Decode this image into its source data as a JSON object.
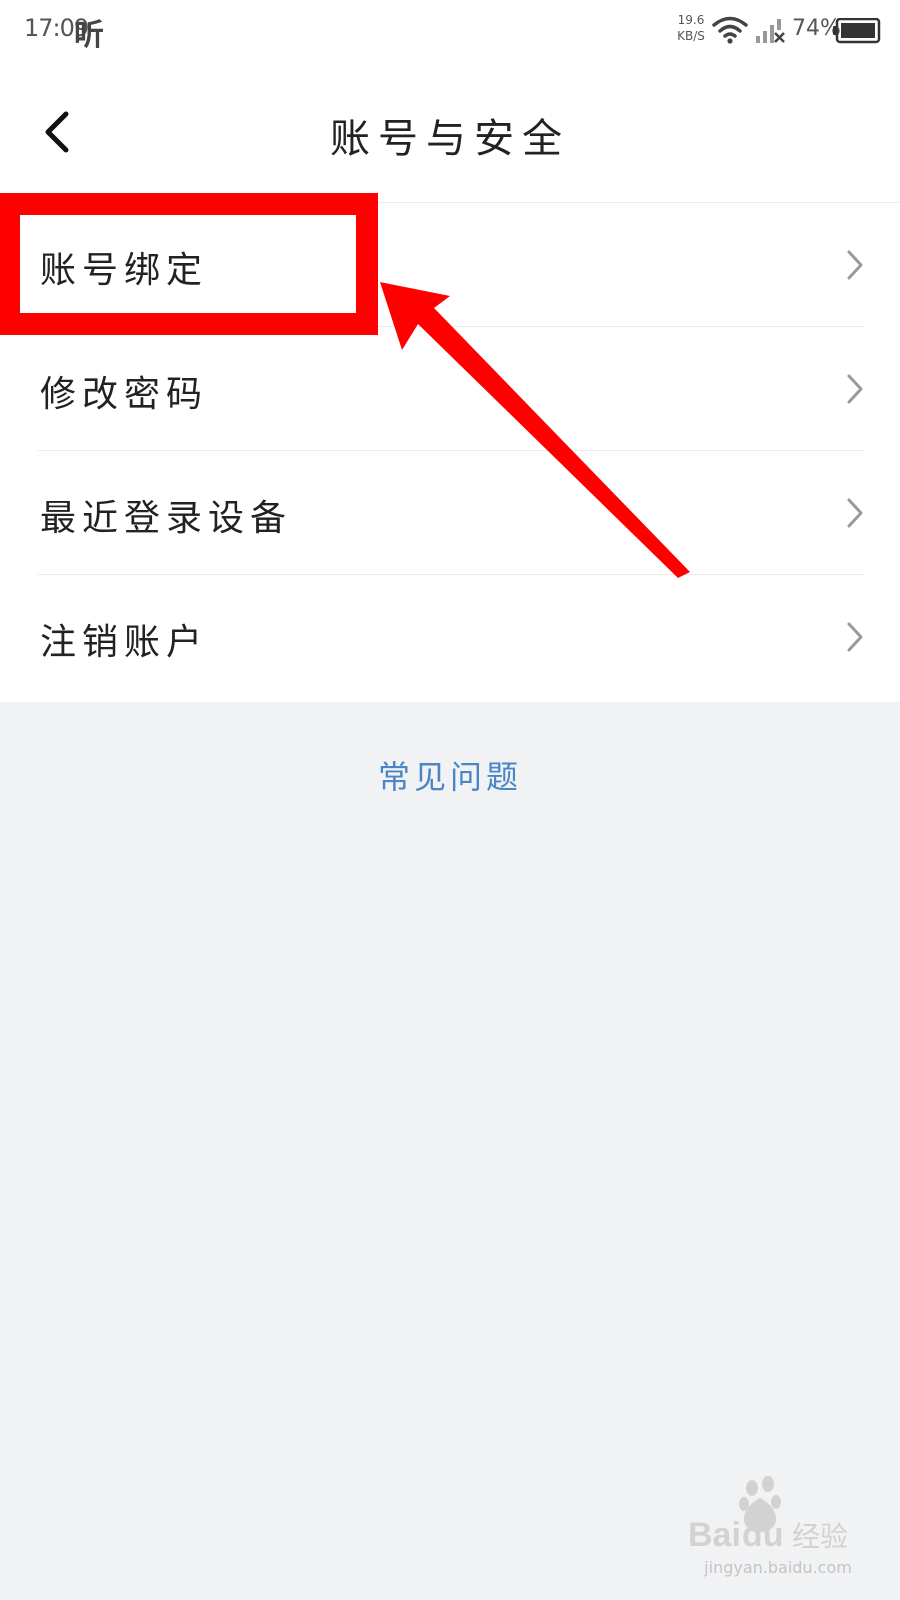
{
  "status_bar": {
    "time": "17:09",
    "app_indicator": "听",
    "net_speed_value": "19.6",
    "net_speed_unit": "KB/S",
    "battery_percent": "74%"
  },
  "header": {
    "title": "账号与安全"
  },
  "menu": {
    "items": [
      {
        "label": "账号绑定"
      },
      {
        "label": "修改密码"
      },
      {
        "label": "最近登录设备"
      },
      {
        "label": "注销账户"
      }
    ]
  },
  "faq": {
    "label": "常见问题"
  },
  "watermark": {
    "brand": "Baidu经验",
    "domain": "jingyan.baidu.com"
  },
  "colors": {
    "annotation": "#ff0000",
    "link": "#4a86c5",
    "background": "#f1f2f4"
  },
  "icons": {
    "back": "chevron-left-icon",
    "item_arrow": "chevron-right-icon",
    "wifi": "wifi-icon",
    "signal": "signal-icon",
    "battery": "battery-icon"
  }
}
